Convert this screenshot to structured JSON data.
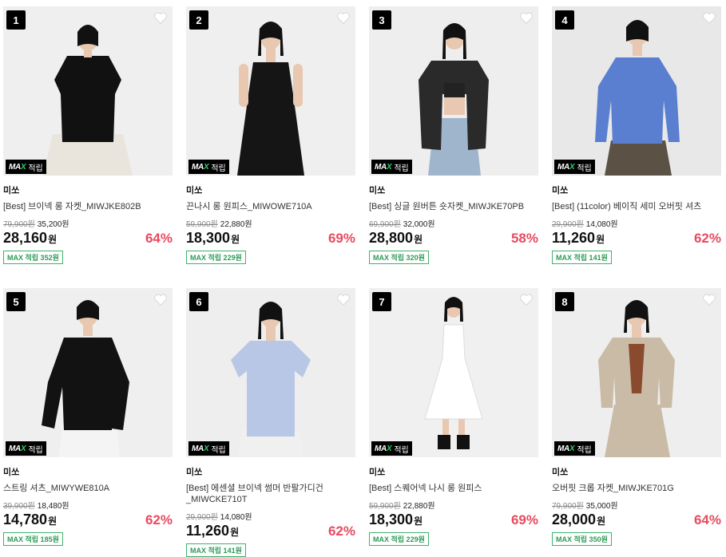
{
  "badge": {
    "max_text": "MAX",
    "earn_text": "적립"
  },
  "products": [
    {
      "rank": "1",
      "brand": "미쏘",
      "name": "[Best] 브이넥 롱 자켓_MIWJKE802B",
      "orig": "79,900원",
      "sub": "35,200원",
      "price": "28,160",
      "won": "원",
      "discount": "64%",
      "points": "MAX 적립 352원",
      "bg": "#efefef",
      "garment": "#111111",
      "lower": "#e9e4dc"
    },
    {
      "rank": "2",
      "brand": "미쏘",
      "name": "끈나시 롱 원피스_MIWOWE710A",
      "orig": "59,900원",
      "sub": "22,880원",
      "price": "18,300",
      "won": "원",
      "discount": "69%",
      "points": "MAX 적립 229원",
      "bg": "#efefef",
      "garment": "#151515",
      "lower": "#151515"
    },
    {
      "rank": "3",
      "brand": "미쏘",
      "name": "[Best] 싱글 원버튼 숏자켓_MIWJKE70PB",
      "orig": "69,900원",
      "sub": "32,000원",
      "price": "28,800",
      "won": "원",
      "discount": "58%",
      "points": "MAX 적립 320원",
      "bg": "#eeeeee",
      "garment": "#2a2a2a",
      "lower": "#9fb5cc"
    },
    {
      "rank": "4",
      "brand": "미쏘",
      "name": "[Best] (11color) 베이직 세미 오버핏 셔츠",
      "orig": "29,900원",
      "sub": "14,080원",
      "price": "11,260",
      "won": "원",
      "discount": "62%",
      "points": "MAX 적립 141원",
      "bg": "#e8e8e8",
      "garment": "#5a7fd0",
      "lower": "#5b5245"
    },
    {
      "rank": "5",
      "brand": "미쏘",
      "name": "스트링 셔츠_MIWYWE810A",
      "orig": "39,900원",
      "sub": "18,480원",
      "price": "14,780",
      "won": "원",
      "discount": "62%",
      "points": "MAX 적립 185원",
      "bg": "#efefef",
      "garment": "#121212",
      "lower": "#f4f4f4"
    },
    {
      "rank": "6",
      "brand": "미쏘",
      "name": "[Best] 에센셜 브이넥 썸머 반팔가디건_MIWCKE710T",
      "orig": "29,900원",
      "sub": "14,080원",
      "price": "11,260",
      "won": "원",
      "discount": "62%",
      "points": "MAX 적립 141원",
      "bg": "#eeeeee",
      "garment": "#b9c7e6",
      "lower": "#f0f0f0"
    },
    {
      "rank": "7",
      "brand": "미쏘",
      "name": "[Best] 스퀘어넥 나시 롱 원피스",
      "orig": "59,900원",
      "sub": "22,880원",
      "price": "18,300",
      "won": "원",
      "discount": "69%",
      "points": "MAX 적립 229원",
      "bg": "#f0f0f0",
      "garment": "#ffffff",
      "lower": "#ffffff"
    },
    {
      "rank": "8",
      "brand": "미쏘",
      "name": "오버핏 크롭 자켓_MIWJKE701G",
      "orig": "79,900원",
      "sub": "35,000원",
      "price": "28,000",
      "won": "원",
      "discount": "64%",
      "points": "MAX 적립 350원",
      "bg": "#eeeeee",
      "garment": "#c9bba6",
      "lower": "#c9bba6"
    }
  ]
}
